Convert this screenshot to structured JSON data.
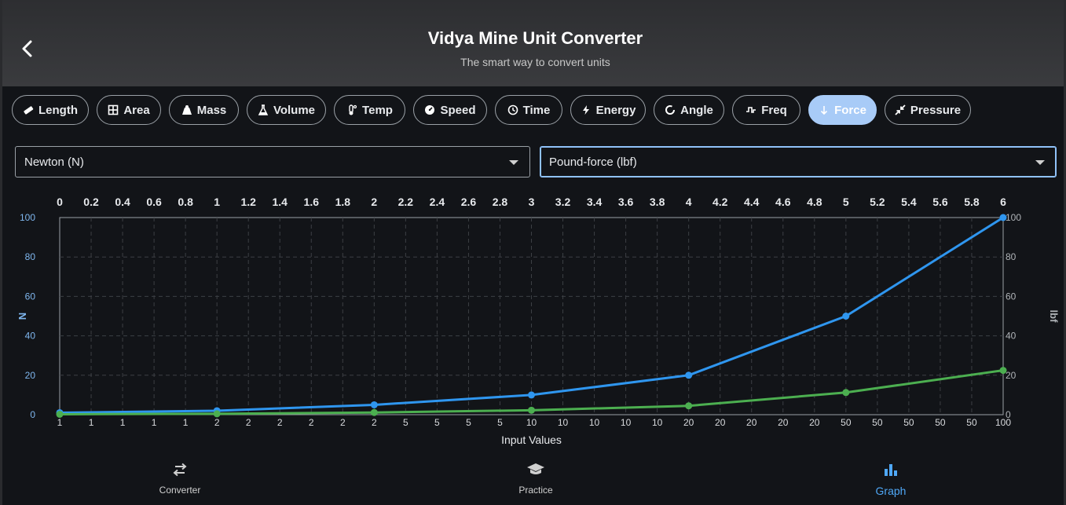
{
  "header": {
    "title": "Vidya Mine Unit Converter",
    "subtitle": "The smart way to convert units"
  },
  "categories": [
    {
      "label": "Length",
      "icon": "ruler-icon"
    },
    {
      "label": "Area",
      "icon": "grid-icon"
    },
    {
      "label": "Mass",
      "icon": "weight-icon"
    },
    {
      "label": "Volume",
      "icon": "flask-icon"
    },
    {
      "label": "Temp",
      "icon": "thermometer-icon"
    },
    {
      "label": "Speed",
      "icon": "speedometer-icon"
    },
    {
      "label": "Time",
      "icon": "clock-icon"
    },
    {
      "label": "Energy",
      "icon": "bolt-icon"
    },
    {
      "label": "Angle",
      "icon": "circle-icon"
    },
    {
      "label": "Freq",
      "icon": "wave-icon"
    },
    {
      "label": "Force",
      "icon": "arrow-down-icon",
      "active": true
    },
    {
      "label": "Pressure",
      "icon": "compress-icon"
    }
  ],
  "from_unit": "Newton (N)",
  "to_unit": "Pound-force (lbf)",
  "colors": {
    "accent": "#4fa8f7",
    "series_n": "#2f96ef",
    "series_lbf": "#4caf50",
    "active_chip": "#a8cbf7"
  },
  "chart_data": {
    "type": "line",
    "x_top_ticks": [
      "0",
      "0.2",
      "0.4",
      "0.6",
      "0.8",
      "1",
      "1.2",
      "1.4",
      "1.6",
      "1.8",
      "2",
      "2.2",
      "2.4",
      "2.6",
      "2.8",
      "3",
      "3.2",
      "3.4",
      "3.6",
      "3.8",
      "4",
      "4.2",
      "4.4",
      "4.6",
      "4.8",
      "5",
      "5.2",
      "5.4",
      "5.6",
      "5.8",
      "6"
    ],
    "x_bottom_ticks": [
      "1",
      "1",
      "1",
      "1",
      "1",
      "2",
      "2",
      "2",
      "2",
      "2",
      "2",
      "5",
      "5",
      "5",
      "5",
      "10",
      "10",
      "10",
      "10",
      "10",
      "20",
      "20",
      "20",
      "20",
      "20",
      "50",
      "50",
      "50",
      "50",
      "50",
      "100"
    ],
    "xlabel": "Input Values",
    "ylabel_left": "N",
    "ylabel_right": "lbf",
    "ylim": [
      0,
      100
    ],
    "y_ticks": [
      "0",
      "20",
      "40",
      "60",
      "80",
      "100"
    ],
    "x": [
      0,
      1,
      2,
      3,
      4,
      5,
      6
    ],
    "series": [
      {
        "name": "N",
        "values": [
          1,
          2,
          5,
          10,
          20,
          50,
          100
        ]
      },
      {
        "name": "lbf",
        "values": [
          0.22,
          0.45,
          1.12,
          2.25,
          4.5,
          11.24,
          22.48
        ]
      }
    ],
    "grid": true
  },
  "nav": [
    {
      "label": "Converter",
      "icon": "swap-icon"
    },
    {
      "label": "Practice",
      "icon": "graduation-cap-icon"
    },
    {
      "label": "Graph",
      "icon": "bar-chart-icon",
      "active": true
    }
  ]
}
